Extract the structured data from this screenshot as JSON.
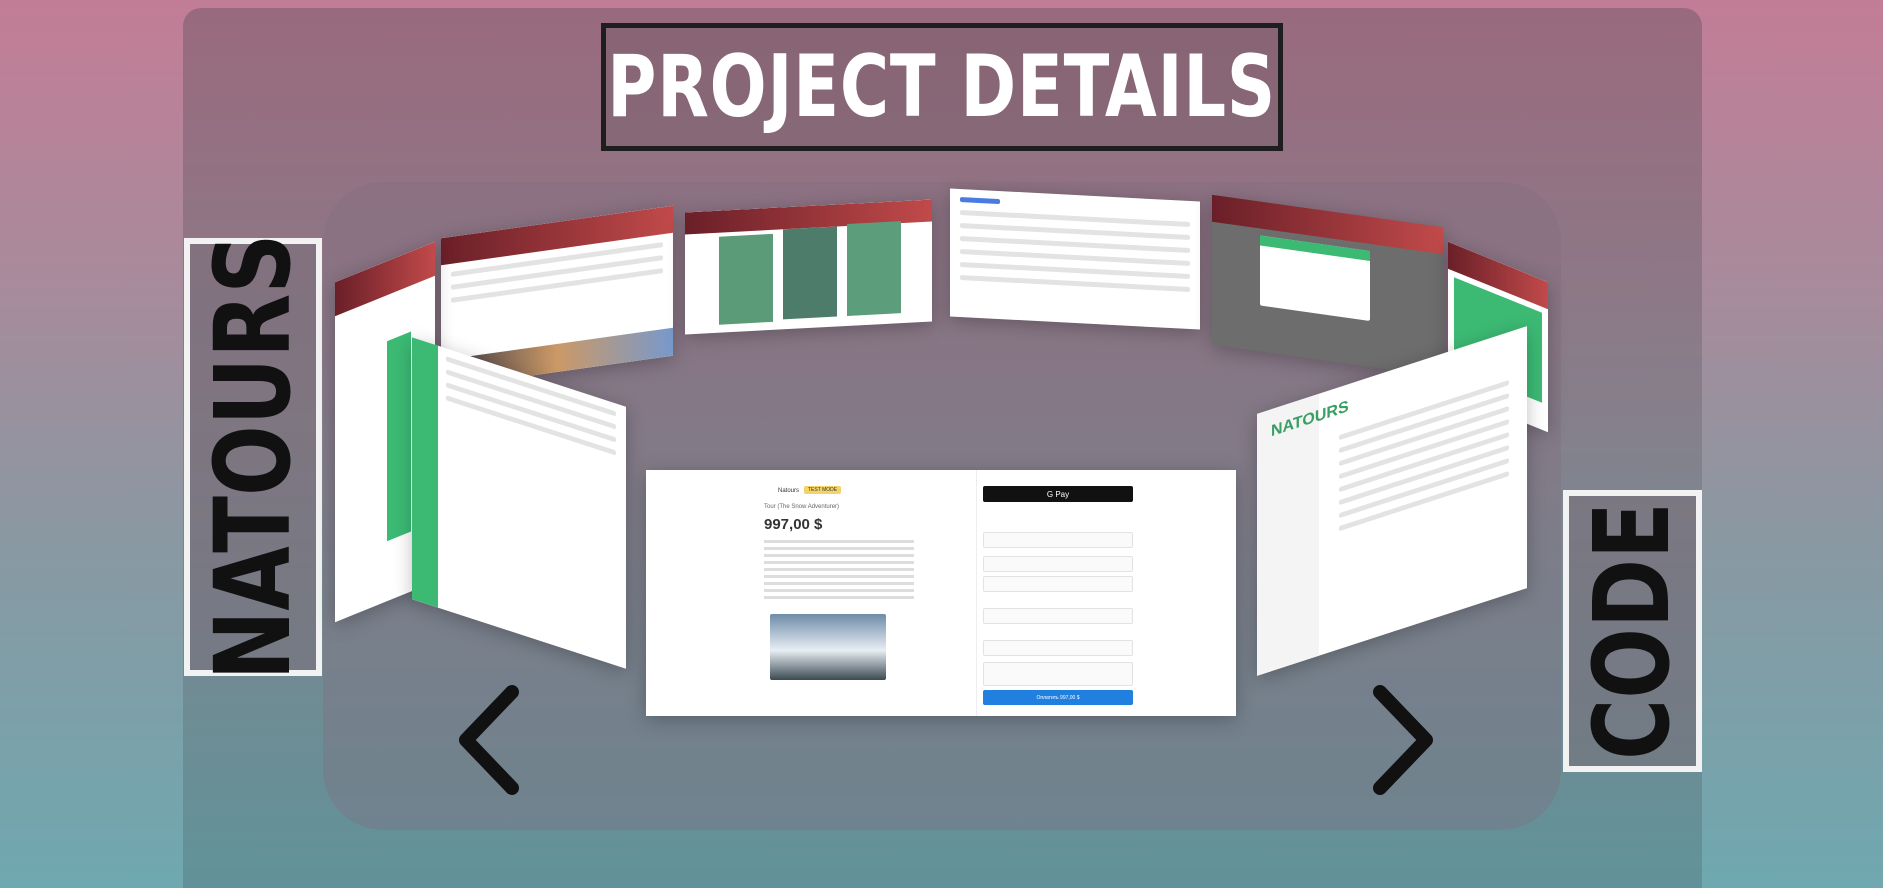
{
  "header": {
    "title": "PROJECT DETAILS"
  },
  "side_labels": {
    "left": "NATOURS",
    "right": "CODE"
  },
  "carousel": {
    "front_card": {
      "brand": "Natours",
      "badge": "TEST MODE",
      "tour_name": "Tour (The Snow Adventurer)",
      "price": "997,00 $",
      "pay_button": "G Pay",
      "submit_button": "Оплатить 997,00 $"
    },
    "prev_icon": "chevron-left-icon",
    "next_icon": "chevron-right-icon"
  },
  "colors": {
    "accent_red": "#b0353c",
    "accent_green": "#3cba74",
    "accent_blue": "#1f80e0"
  }
}
